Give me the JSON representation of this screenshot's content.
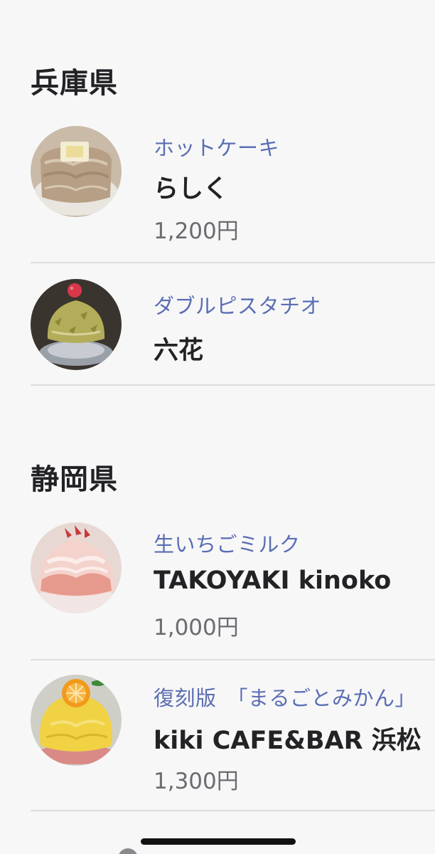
{
  "sections": [
    {
      "prefecture": "兵庫県",
      "items": [
        {
          "menu": "ホットケーキ",
          "shop": "らしく",
          "price": "1,200円",
          "image": "hotcake-kakigori-photo"
        },
        {
          "menu": "ダブルピスタチオ",
          "shop": "六花",
          "price": "",
          "image": "pistachio-kakigori-photo"
        }
      ]
    },
    {
      "prefecture": "静岡県",
      "items": [
        {
          "menu": "生いちごミルク",
          "shop": "TAKOYAKI kinoko",
          "price": "1,000円",
          "image": "strawberry-milk-kakigori-photo"
        },
        {
          "menu": "復刻版　「まるごとみかん」",
          "shop": "kiki CAFE&BAR 浜松",
          "price": "1,300円",
          "image": "mandarin-kakigori-photo"
        }
      ]
    }
  ],
  "colors": {
    "background": "#f7f7f8",
    "menu_accent": "#5b6eb3",
    "divider": "#dcdde0"
  }
}
